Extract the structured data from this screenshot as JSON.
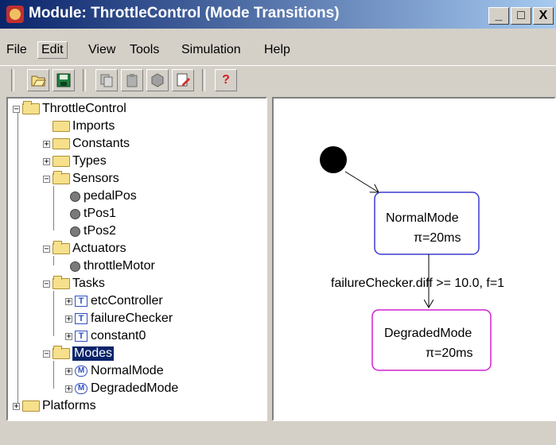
{
  "window": {
    "title": "Module: ThrottleControl (Mode Transitions)"
  },
  "window_buttons": {
    "minimize": "_",
    "maximize": "□",
    "close": "X"
  },
  "menu": [
    "File",
    "Edit",
    "View",
    "Tools",
    "Simulation",
    "Help"
  ],
  "toolbar": [
    "open-icon",
    "save-icon",
    "copy-icon",
    "paste-icon",
    "delete-icon",
    "edit-icon",
    "help-icon"
  ],
  "toolbar_glyphs": {
    "help": "?"
  },
  "tree": {
    "root": "ThrottleControl",
    "imports": "Imports",
    "constants": "Constants",
    "types": "Types",
    "sensors": "Sensors",
    "sensor_items": [
      "pedalPos",
      "tPos1",
      "tPos2"
    ],
    "actuators": "Actuators",
    "actuator_items": [
      "throttleMotor"
    ],
    "tasks": "Tasks",
    "task_items": [
      "etcController",
      "failureChecker",
      "constant0"
    ],
    "modes": "Modes",
    "mode_items": [
      "NormalMode",
      "DegradedMode"
    ],
    "platforms": "Platforms",
    "task_glyph": "T",
    "mode_glyph": "M"
  },
  "diagram": {
    "state1": {
      "name": "NormalMode",
      "period": "π=20ms",
      "color": "#3c3cd0"
    },
    "state2": {
      "name": "DegradedMode",
      "period": "π=20ms",
      "color": "#d020d0"
    },
    "transition_label": "failureChecker.diff >= 10.0, f=1"
  }
}
